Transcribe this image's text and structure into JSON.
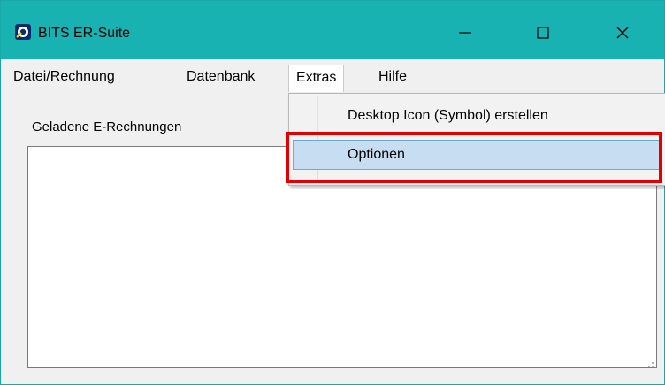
{
  "window": {
    "title": "BITS ER-Suite",
    "titlebar_color": "#19b2b2",
    "controls": [
      "minimize-icon",
      "maximize-icon",
      "close-icon"
    ]
  },
  "menubar": {
    "items": [
      {
        "label": "Datei/Rechnung"
      },
      {
        "label": "Datenbank"
      },
      {
        "label": "Extras",
        "open": true
      },
      {
        "label": "Hilfe"
      }
    ]
  },
  "main": {
    "list_label": "Geladene E-Rechnungen",
    "list_items": []
  },
  "dropdown": {
    "items": [
      {
        "label": "Desktop Icon (Symbol) erstellen"
      },
      {
        "label": "Optionen",
        "highlighted": true
      }
    ],
    "highlight_color": "#c7ddf2"
  },
  "annotation": {
    "highlight_color": "#e00000"
  }
}
